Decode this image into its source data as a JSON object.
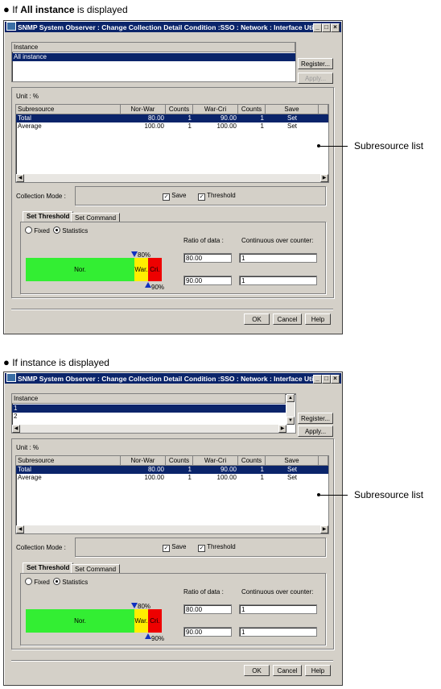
{
  "sections": [
    {
      "heading_prefix": "If ",
      "heading_bold": "All instance",
      "heading_suffix": " is displayed",
      "window_title": "SNMP System Observer : Change Collection Detail Condition :SSO : Network : Interface Util...",
      "instance_header": "Instance",
      "instances": [
        "All instance"
      ],
      "register_label": "Register...",
      "apply_label": "Apply...",
      "unit_label": "Unit : %",
      "columns": [
        "Subresource",
        "Nor-War",
        "Counts",
        "War-Cri",
        "Counts",
        "Save"
      ],
      "rows": [
        {
          "name": "Total",
          "norwar": "80.00",
          "c1": "1",
          "warcri": "90.00",
          "c2": "1",
          "save": "Set"
        },
        {
          "name": "Average",
          "norwar": "100.00",
          "c1": "1",
          "warcri": "100.00",
          "c2": "1",
          "save": "Set"
        }
      ],
      "collection_mode_label": "Collection Mode :",
      "save_check": "Save",
      "threshold_check": "Threshold",
      "tab_threshold": "Set Threshold",
      "tab_command": "Set Command",
      "radio_fixed": "Fixed",
      "radio_statistics": "Statistics",
      "ratio_label": "Ratio of data :",
      "counter_label": "Continuous over counter:",
      "ratio_1": "80.00",
      "counter_1": "1",
      "ratio_2": "90.00",
      "counter_2": "1",
      "gauge_nor": "Nor.",
      "gauge_war": "War.",
      "gauge_cri": "Cri.",
      "marker_top": "80%",
      "marker_bottom": "90%",
      "ok_label": "OK",
      "cancel_label": "Cancel",
      "help_label": "Help",
      "callout": "Subresource list"
    },
    {
      "heading_prefix": "If instance is displayed",
      "heading_bold": "",
      "heading_suffix": "",
      "window_title": "SNMP System Observer : Change Collection Detail Condition :SSO : Network : Interface Util...",
      "instance_header": "Instance",
      "instances": [
        "1",
        "2"
      ],
      "register_label": "Register...",
      "apply_label": "Apply...",
      "unit_label": "Unit : %",
      "columns": [
        "Subresource",
        "Nor-War",
        "Counts",
        "War-Cri",
        "Counts",
        "Save"
      ],
      "rows": [
        {
          "name": "Total",
          "norwar": "80.00",
          "c1": "1",
          "warcri": "90.00",
          "c2": "1",
          "save": "Set"
        },
        {
          "name": "Average",
          "norwar": "100.00",
          "c1": "1",
          "warcri": "100.00",
          "c2": "1",
          "save": "Set"
        }
      ],
      "collection_mode_label": "Collection Mode :",
      "save_check": "Save",
      "threshold_check": "Threshold",
      "tab_threshold": "Set Threshold",
      "tab_command": "Set Command",
      "radio_fixed": "Fixed",
      "radio_statistics": "Statistics",
      "ratio_label": "Ratio of data :",
      "counter_label": "Continuous over counter:",
      "ratio_1": "80.00",
      "counter_1": "1",
      "ratio_2": "90.00",
      "counter_2": "1",
      "gauge_nor": "Nor.",
      "gauge_war": "War.",
      "gauge_cri": "Cri.",
      "marker_top": "80%",
      "marker_bottom": "90%",
      "ok_label": "OK",
      "cancel_label": "Cancel",
      "help_label": "Help",
      "callout": "Subresource list"
    }
  ],
  "colors": {
    "titlebar": "#0a246a",
    "gauge_normal": "#33ee33",
    "gauge_warning": "#ffee00",
    "gauge_critical": "#ee0000",
    "marker": "#1030c0"
  },
  "icons": [
    "bullet-icon",
    "app-icon",
    "minimize-icon",
    "maximize-icon",
    "close-icon",
    "scroll-up-icon",
    "scroll-down-icon",
    "scroll-left-icon",
    "scroll-right-icon",
    "checkbox-checked-icon",
    "radio-icon",
    "threshold-marker-icon"
  ]
}
